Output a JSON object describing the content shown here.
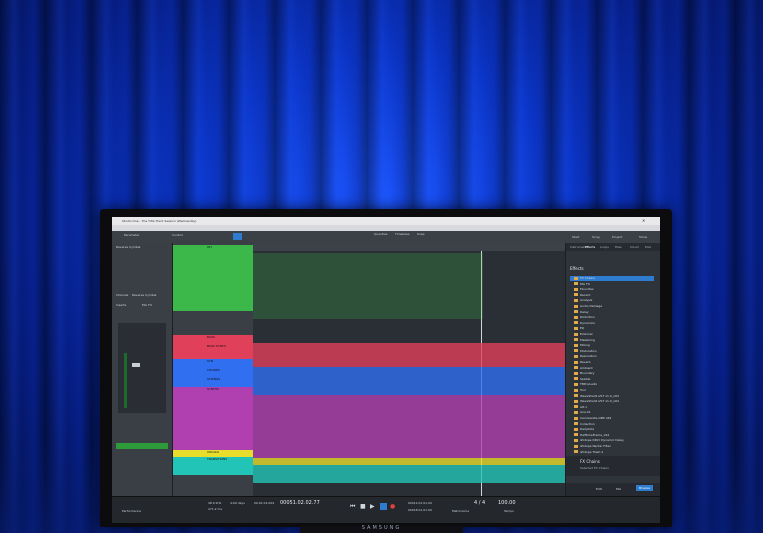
{
  "scene": {
    "monitor_brand": "SAMSUNG"
  },
  "app": {
    "window_title": "Studio One - The Title Track Session (Wednesday)",
    "menu": [
      "File",
      "Edit",
      "Song",
      "Track",
      "Event",
      "Audio",
      "Transport",
      "View",
      "Studio One",
      "Help"
    ],
    "toolbar": {
      "left_dropdowns": [
        "Parameter",
        "Control"
      ],
      "quantize_label": "Quantize",
      "timebase_label": "Timebase",
      "snap_label": "Snap",
      "right_buttons": [
        "Start",
        "Song",
        "Project",
        "Show"
      ]
    },
    "inspector": {
      "header": "Reverse Cymbal",
      "section": "Channel",
      "channel_name": "Reverse Cymbal",
      "sends_label": "Inserts",
      "fx_label": "Mix FX"
    },
    "tracks": [
      {
        "name": "OH",
        "color": "#3cb84a"
      },
      {
        "name": "BASS",
        "color": "#e0405a"
      },
      {
        "name": "BASS SYNTH",
        "color": "#e0405a"
      },
      {
        "name": "SYN",
        "color": "#2f6ff0"
      },
      {
        "name": "CHORDS",
        "color": "#2f6ff0"
      },
      {
        "name": "STRINGS",
        "color": "#2f6ff0"
      },
      {
        "name": "SYNTHS",
        "color": "#b040b0"
      },
      {
        "name": "VOCALS",
        "color": "#e8dd2a"
      },
      {
        "name": "TRANSITIONS",
        "color": "#23c4b8"
      }
    ],
    "browser": {
      "tabs": [
        "Instruments",
        "Effects",
        "Loops",
        "Files",
        "Cloud",
        "Pool"
      ],
      "title": "Effects",
      "items": [
        "FX Chains",
        "Mix FX",
        "Favorites",
        "Recent",
        "Analysis",
        "Audio Damage",
        "Delay",
        "Distortion",
        "Dynamics",
        "EQ",
        "External",
        "Mastering",
        "Mixing",
        "Modulation",
        "Resonation",
        "Reverb",
        "Ambient",
        "Boundary",
        "Spatial",
        "TBProAudio",
        "Tool",
        "WaveShell1-VST 11.0_x64",
        "WaveShell1-VST 11.0_x64",
        "Alt-1",
        "Ana-01",
        "Ceruleanite-OBP x64",
        "Collection",
        "Dailybots",
        "HalftimeFrame_x64",
        "iZotope DDLY Dynamic Delay",
        "iZotope Nectar Filter",
        "iZotope Trash 2"
      ],
      "footer_title": "FX Chains",
      "footer_sub": "Selected FX Chains",
      "footer_buttons": [
        "Edit",
        "Mix",
        "Browse"
      ]
    },
    "transport": {
      "sample_rate": "48.0 kHz",
      "latency": "271.2 ms",
      "record_max": "4:09 days",
      "time": "00:01:01.004",
      "bars": "00051.02.02.77",
      "loop_start": "00012.01.01.00",
      "loop_end": "00018.01.01.00",
      "signature": "4 / 4",
      "tempo": "100.00",
      "performance_label": "Performance",
      "metronome_label": "Metronome",
      "tempo_label": "Tempo"
    }
  },
  "colors": {
    "curtain": "#0b36c9",
    "accent_blue": "#2d7cd0"
  }
}
